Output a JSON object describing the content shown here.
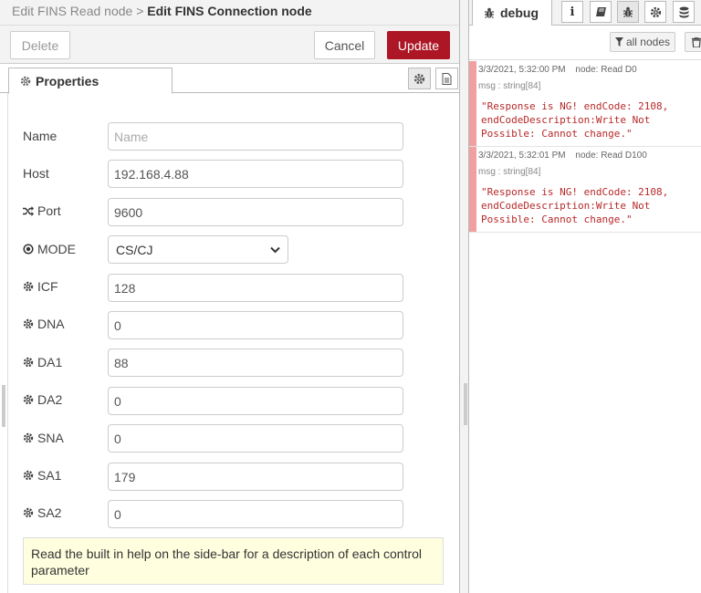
{
  "editor": {
    "breadcrumb": {
      "parent": "Edit FINS Read node",
      "separator": ">",
      "current": "Edit FINS Connection node"
    },
    "toolbar": {
      "delete_label": "Delete",
      "cancel_label": "Cancel",
      "update_label": "Update"
    },
    "tabs": {
      "properties_label": "Properties"
    },
    "form": {
      "name": {
        "label": "Name",
        "value": "",
        "placeholder": "Name"
      },
      "host": {
        "label": "Host",
        "value": "192.168.4.88"
      },
      "port": {
        "label": "Port",
        "value": "9600"
      },
      "mode": {
        "label": "MODE",
        "value": "CS/CJ"
      },
      "icf": {
        "label": "ICF",
        "value": "128"
      },
      "dna": {
        "label": "DNA",
        "value": "0"
      },
      "da1": {
        "label": "DA1",
        "value": "88"
      },
      "da2": {
        "label": "DA2",
        "value": "0"
      },
      "sna": {
        "label": "SNA",
        "value": "0"
      },
      "sa1": {
        "label": "SA1",
        "value": "179"
      },
      "sa2": {
        "label": "SA2",
        "value": "0"
      }
    },
    "help_text": "Read the built in help on the side-bar for a description of each control parameter"
  },
  "sidebar": {
    "active_tab_label": "debug",
    "filter_label": "all nodes",
    "messages": [
      {
        "timestamp": "3/3/2021, 5:32:00 PM",
        "node": "node: Read D0",
        "type": "msg : string[84]",
        "payload": "\"Response is NG! endCode: 2108, endCodeDescription:Write Not Possible: Cannot change.\""
      },
      {
        "timestamp": "3/3/2021, 5:32:01 PM",
        "node": "node: Read D100",
        "type": "msg : string[84]",
        "payload": "\"Response is NG! endCode: 2108, endCodeDescription:Write Not Possible: Cannot change.\""
      }
    ]
  },
  "colors": {
    "accent": "#ad1625",
    "error_bar": "#f0a0a0",
    "error_text": "#b72828",
    "help_bg": "#ffffe0"
  }
}
